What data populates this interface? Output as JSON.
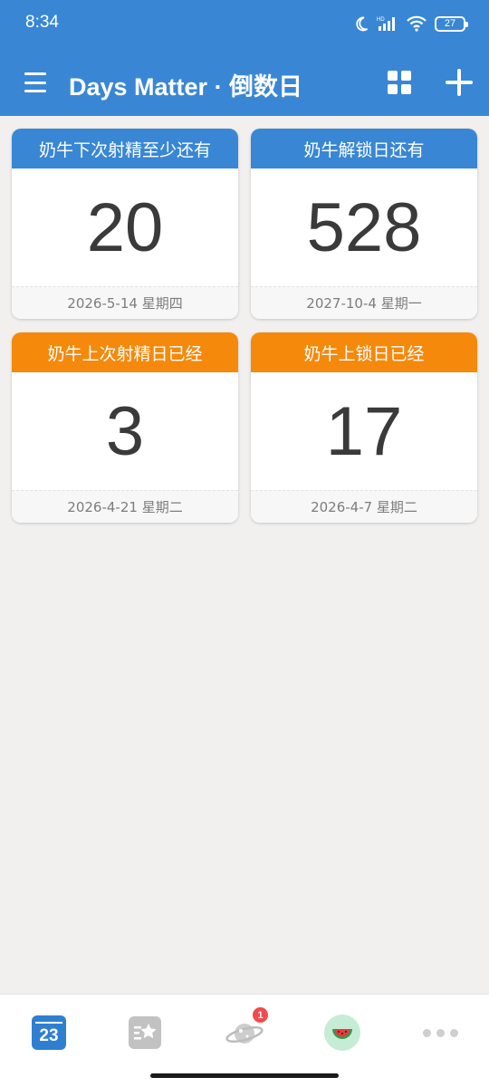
{
  "status_bar": {
    "time": "8:34",
    "battery": "27",
    "icons": [
      "moon-icon",
      "signal-icon",
      "wifi-icon",
      "battery-icon"
    ]
  },
  "app_bar": {
    "title": "Days Matter · 倒数日",
    "icons": [
      "menu-icon",
      "grid-view-icon",
      "add-icon"
    ]
  },
  "colors": {
    "primary": "#3987d4",
    "accent_orange": "#f5890c",
    "background": "#f1f0ef",
    "number_text": "#3a3a3a"
  },
  "cards": [
    {
      "title": "奶牛下次射精至少还有",
      "number": "20",
      "date": "2026-5-14 星期四",
      "color": "blue"
    },
    {
      "title": "奶牛解锁日还有",
      "number": "528",
      "date": "2027-10-4 星期一",
      "color": "blue"
    },
    {
      "title": "奶牛上次射精日已经",
      "number": "3",
      "date": "2026-4-21 星期二",
      "color": "orange"
    },
    {
      "title": "奶牛上锁日已经",
      "number": "17",
      "date": "2026-4-7 星期二",
      "color": "orange"
    }
  ],
  "bottom_nav": {
    "calendar_day": "23",
    "planet_badge": "1",
    "items": [
      "calendar-icon",
      "star-list-icon",
      "planet-icon",
      "watermelon-icon",
      "more-icon"
    ]
  }
}
